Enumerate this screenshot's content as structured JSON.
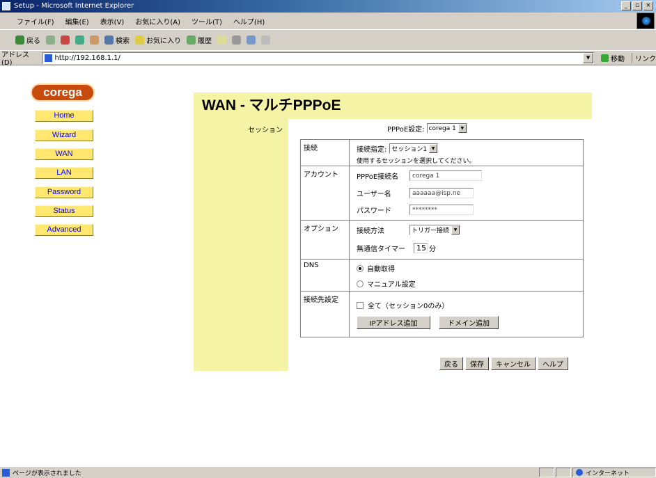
{
  "window": {
    "title": "Setup - Microsoft Internet Explorer",
    "controls": [
      "_",
      "▫",
      "×"
    ]
  },
  "menu": [
    "ファイル(F)",
    "編集(E)",
    "表示(V)",
    "お気に入り(A)",
    "ツール(T)",
    "ヘルプ(H)"
  ],
  "toolbar": {
    "back": "戻る",
    "search": "検索",
    "favorites": "お気に入り",
    "history": "履歴"
  },
  "address": {
    "label": "アドレス(D)",
    "url": "http://192.168.1.1/",
    "go": "移動",
    "links": "リンク"
  },
  "sidebar": {
    "logo": "corega",
    "items": [
      "Home",
      "Wizard",
      "WAN",
      "LAN",
      "Password",
      "Status",
      "Advanced"
    ]
  },
  "page": {
    "title": "WAN - マルチPPPoE",
    "session_label": "セッション",
    "pppoe_setting_label": "PPPoE設定:",
    "pppoe_setting_value": "corega 1"
  },
  "sections": {
    "connection": {
      "label": "接続",
      "field_label": "接続指定:",
      "field_value": "セッション1",
      "hint": "使用するセッションを選択してください。"
    },
    "account": {
      "label": "アカウント",
      "conn_name_label": "PPPoE接続名",
      "conn_name_value": "corega 1",
      "username_label": "ユーザー名",
      "username_value": "aaaaaa@isp.ne",
      "password_label": "パスワード",
      "password_value": "********"
    },
    "options": {
      "label": "オプション",
      "method_label": "接続方法",
      "method_value": "トリガー接続",
      "timer_label": "無通信タイマー",
      "timer_value": "15",
      "timer_unit": "分"
    },
    "dns": {
      "label": "DNS",
      "auto_label": "自動取得",
      "manual_label": "マニュアル設定",
      "selected": "auto"
    },
    "destination": {
      "label": "接続先設定",
      "any_label": "全て（セッション0のみ）",
      "add_ip": "IPアドレス追加",
      "add_domain": "ドメイン追加"
    }
  },
  "actions": {
    "back": "戻る",
    "save": "保存",
    "cancel": "キャンセル",
    "help": "ヘルプ"
  },
  "status": {
    "text": "ページが表示されました",
    "zone": "インターネット"
  },
  "colors": {
    "panel": "#f5f3a6",
    "nav_button": "#ffe770",
    "nav_text": "#0000ff",
    "logo": "#c84b0e"
  }
}
